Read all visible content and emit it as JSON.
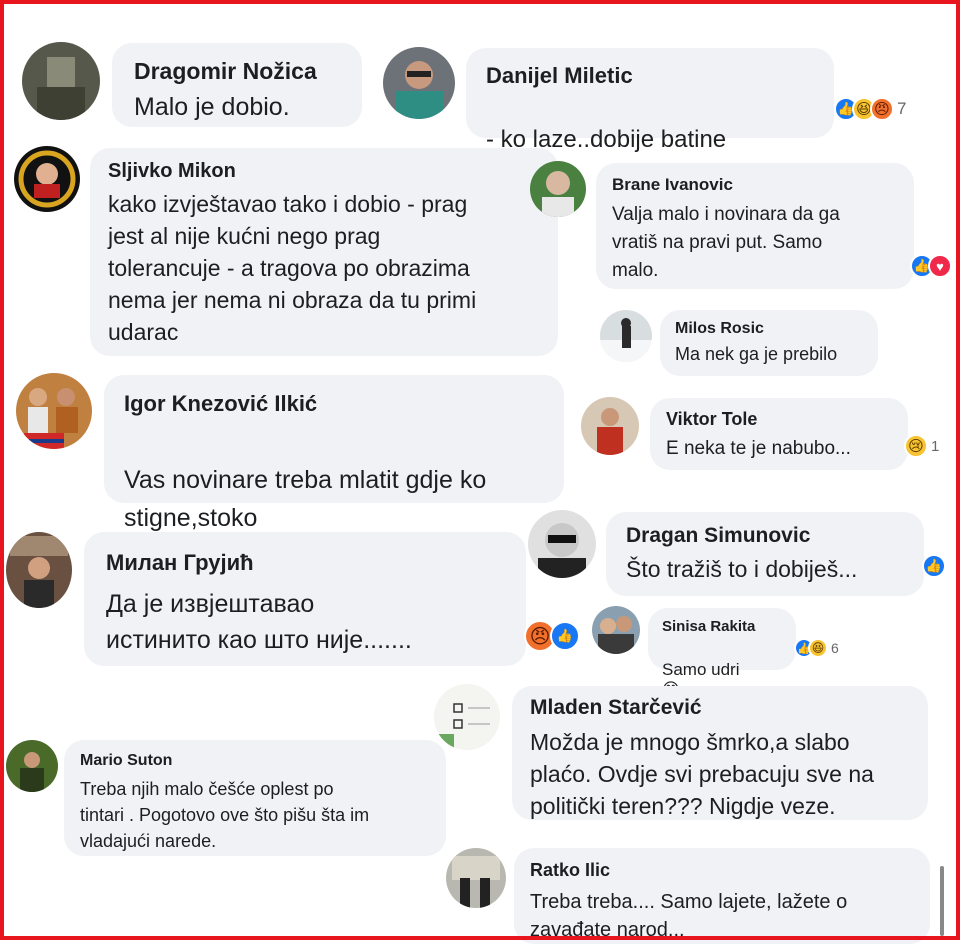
{
  "comments": [
    {
      "name": "Dragomir Nožica",
      "text": "Malo je dobio."
    },
    {
      "name": "Danijel Miletic",
      "text": "- ko laze..dobije batine",
      "emoji": "😎",
      "reaction_count": "7"
    },
    {
      "name": "Sljivko Mikon",
      "text": "kako izvještavao tako i dobio - prag\njest al nije kućni nego prag\ntolerancuje - a tragova po obrazima\nnema jer nema ni obraza da tu primi\nudarac"
    },
    {
      "name": "Brane Ivanovic",
      "text": "Valja malo i novinara da ga\nvratiš na pravi put. Samo\nmalo."
    },
    {
      "name": "Milos Rosic",
      "text": "Ma nek ga je prebilo"
    },
    {
      "name": "Igor Knezović Ilkić",
      "text": "Vas novinare treba mlatit gdje ko\nstigne,stoko",
      "emoji": "😦"
    },
    {
      "name": "Viktor Tole",
      "text": "E neka te je nabubo...",
      "reaction_count": "1"
    },
    {
      "name": "Dragan Simunovic",
      "text": "Što tražiš to i dobiješ..."
    },
    {
      "name": "Милан Грујић",
      "text": "Да је извјештавао\nистинито као што није......."
    },
    {
      "name": "Sinisa Rakita",
      "text": "Samo udri",
      "emoji": "😊",
      "reaction_count": "6"
    },
    {
      "name": "Mladen Starčević",
      "text": "Možda je mnogo šmrko,a slabo\nplaćo. Ovdje svi prebacuju sve na\npolitički  teren???  Nigdje veze."
    },
    {
      "name": "Mario Suton",
      "text": "Treba njih malo češće oplest po\ntintari . Pogotovo ove što pišu šta im\nvladajući narede."
    },
    {
      "name": "Ratko Ilic",
      "text": "Treba treba.... Samo lajete, lažete o\nzavađate narod..."
    }
  ],
  "colors": {
    "frame": "#e8141e",
    "bubble": "#f0f2f5",
    "like": "#1877f2"
  }
}
